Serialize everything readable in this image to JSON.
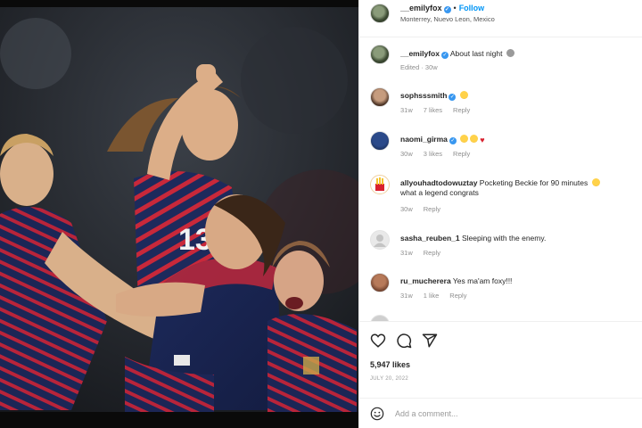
{
  "post": {
    "author": "__emilyfox",
    "follow_label": "Follow",
    "location": "Monterrey, Nuevo Leon, Mexico"
  },
  "caption": {
    "user": "__emilyfox",
    "text": "About last night",
    "meta": "Edited · 30w"
  },
  "comments": [
    {
      "user": "sophsssmith",
      "text": "",
      "time": "31w",
      "likes": "7 likes",
      "reply": "Reply",
      "emoji": [
        "face"
      ]
    },
    {
      "user": "naomi_girma",
      "text": "",
      "time": "30w",
      "likes": "3 likes",
      "reply": "Reply",
      "emoji": [
        "face",
        "face",
        "heart"
      ]
    },
    {
      "user": "allyouhadtodowuztay",
      "text": "Pocketing Beckie for 90 minutes",
      "text2": "what a legend congrats",
      "time": "30w",
      "likes": "",
      "reply": "Reply"
    },
    {
      "user": "sasha_reuben_1",
      "text": "Sleeping with the enemy.",
      "time": "31w",
      "likes": "",
      "reply": "Reply"
    },
    {
      "user": "ru_mucherera",
      "text": "Yes ma'am foxy!!!",
      "time": "31w",
      "likes": "1 like",
      "reply": "Reply"
    }
  ],
  "likes": "5,947 likes",
  "date": "JULY 20, 2022",
  "add_comment": {
    "placeholder": "Add a comment..."
  },
  "colors": {
    "follow": "#0095f6",
    "verified": "#3897f0",
    "muted": "#8e8e8e"
  },
  "icons": [
    "heart-icon",
    "comment-icon",
    "share-icon",
    "smiley-icon",
    "verified-badge-icon"
  ]
}
